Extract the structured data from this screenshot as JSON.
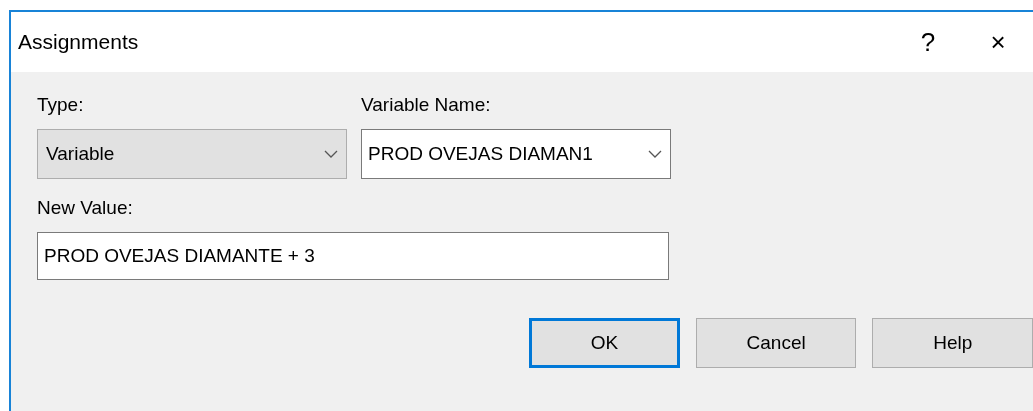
{
  "window": {
    "title": "Assignments",
    "help_glyph": "?",
    "close_glyph": "×"
  },
  "type_field": {
    "label": "Type:",
    "value": "Variable",
    "editable": false
  },
  "variable_name_field": {
    "label": "Variable Name:",
    "value": "PROD OVEJAS DIAMAN1",
    "editable": true
  },
  "new_value_field": {
    "label": "New Value:",
    "value": "PROD OVEJAS DIAMANTE + 3"
  },
  "buttons": [
    {
      "label": "OK",
      "default": true
    },
    {
      "label": "Cancel",
      "default": false
    },
    {
      "label": "Help",
      "default": false
    }
  ]
}
